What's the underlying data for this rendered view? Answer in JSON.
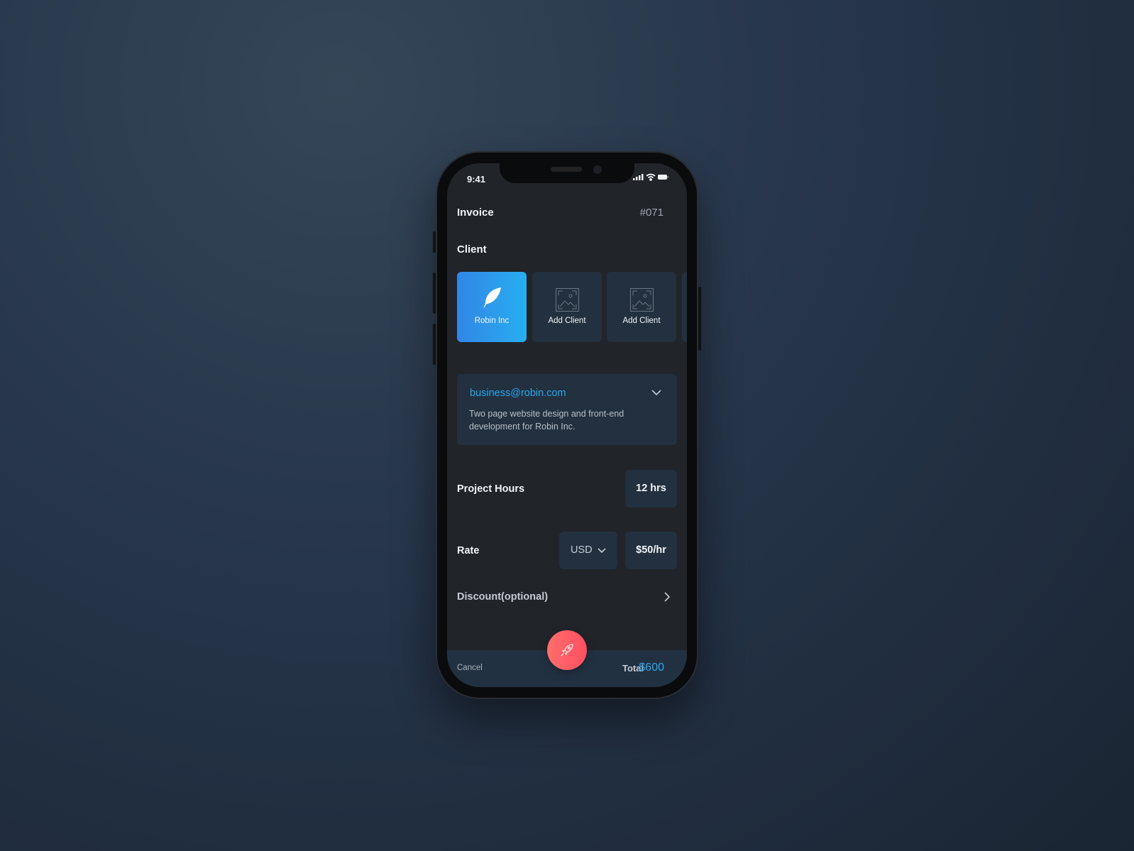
{
  "status": {
    "time": "9:41"
  },
  "header": {
    "title": "Invoice",
    "number": "#071"
  },
  "client": {
    "label": "Client",
    "cards": [
      {
        "label": "Robin Inc",
        "icon": "feather-icon",
        "selected": true
      },
      {
        "label": "Add Client",
        "icon": "image-placeholder-icon"
      },
      {
        "label": "Add Client",
        "icon": "image-placeholder-icon"
      }
    ]
  },
  "details": {
    "email": "business@robin.com",
    "description": "Two page website design and front-end development for Robin Inc."
  },
  "hours": {
    "label": "Project Hours",
    "value": "12 hrs"
  },
  "rate": {
    "label": "Rate",
    "currency": "USD",
    "value": "$50/hr"
  },
  "discount": {
    "label": "Discount(optional)"
  },
  "footer": {
    "cancel": "Cancel",
    "total_label": "Total",
    "total": "$600"
  },
  "colors": {
    "accent": "#29a8ef",
    "send": "#ff5a64"
  }
}
